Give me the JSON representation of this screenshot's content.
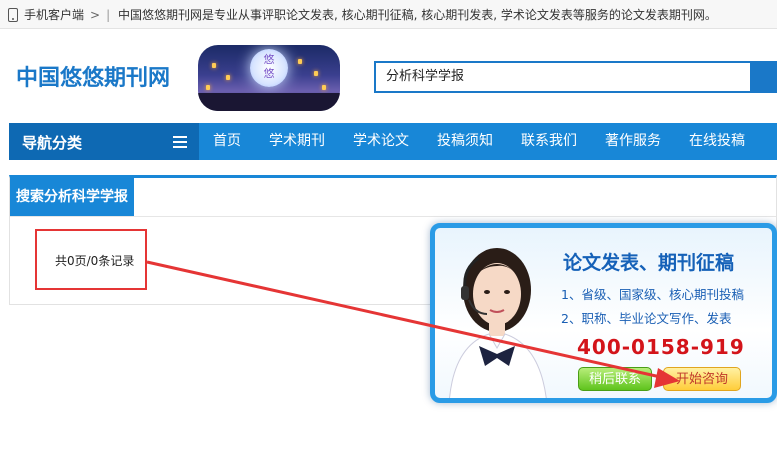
{
  "topbar": {
    "mobile_label": "手机客户端",
    "separator": "|",
    "notice": "中国悠悠期刊网是专业从事评职论文发表, 核心期刊征稿, 核心期刊发表, 学术论文发表等服务的论文发表期刊网。"
  },
  "header": {
    "logo_text": "中国悠悠期刊网",
    "banner_text": "悠悠",
    "search_value": "分析科学学报"
  },
  "nav": {
    "category_label": "导航分类",
    "items": [
      "首页",
      "学术期刊",
      "学术论文",
      "投稿须知",
      "联系我们",
      "著作服务",
      "在线投稿"
    ]
  },
  "results": {
    "tab_label": "搜索分析科学学报",
    "count_text": "共0页/0条记录"
  },
  "consult": {
    "headline": "论文发表、期刊征稿",
    "line1": "1、省级、国家级、核心期刊投稿",
    "line2": "2、职称、毕业论文写作、发表",
    "phone": "400-0158-919",
    "later_label": "稍后联系",
    "start_label": "开始咨询"
  },
  "colors": {
    "primary_blue": "#1887d7",
    "dark_blue": "#0e69b3",
    "annotation_red": "#e53535",
    "phone_red": "#d3141a"
  },
  "icons": [
    "phone-icon",
    "chevron-right-icon",
    "menu-list-icon",
    "search-icon"
  ]
}
